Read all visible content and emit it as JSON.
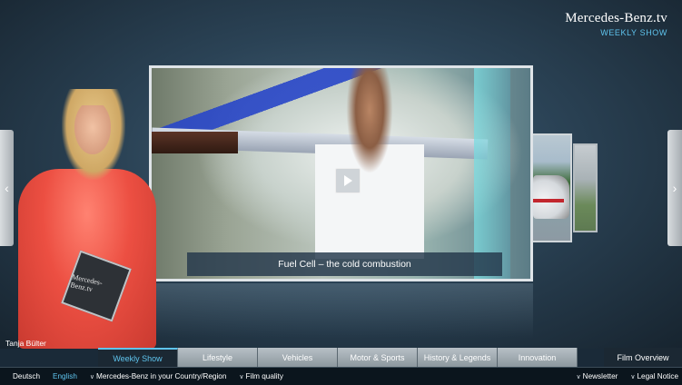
{
  "brand": {
    "name": "Mercedes-Benz.tv",
    "section": "WEEKLY SHOW"
  },
  "carousel": {
    "main_caption": "Fuel Cell – the cold combustion",
    "play_icon": "play-icon",
    "prev_icon": "chevron-left-icon",
    "next_icon": "chevron-right-icon",
    "prev_glyph": "‹",
    "next_glyph": "›"
  },
  "presenter": {
    "name": "Tanja Bülter",
    "card_text": "Mercedes-Benz.tv"
  },
  "tabs": [
    {
      "label": "Weekly Show",
      "active": true
    },
    {
      "label": "Lifestyle",
      "active": false
    },
    {
      "label": "Vehicles",
      "active": false
    },
    {
      "label": "Motor & Sports",
      "active": false
    },
    {
      "label": "History & Legends",
      "active": false
    },
    {
      "label": "Innovation",
      "active": false
    }
  ],
  "film_overview": "Film Overview",
  "footer": {
    "lang_de": "Deutsch",
    "lang_en": "English",
    "country": "Mercedes-Benz in your Country/Region",
    "quality": "Film quality",
    "newsletter": "Newsletter",
    "legal": "Legal Notice"
  },
  "colors": {
    "accent": "#5fc4ee",
    "footer_bg": "#0b151d"
  }
}
